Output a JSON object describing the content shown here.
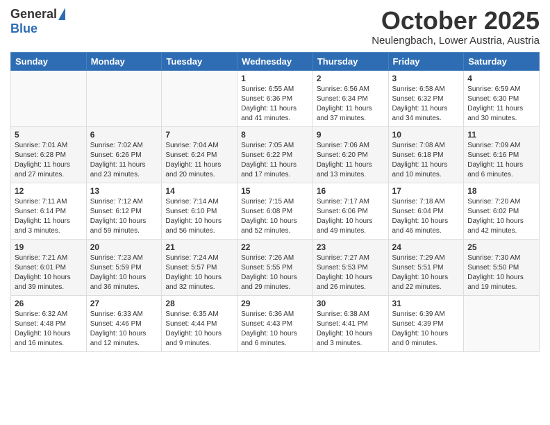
{
  "logo": {
    "general": "General",
    "blue": "Blue"
  },
  "title": "October 2025",
  "location": "Neulengbach, Lower Austria, Austria",
  "weekdays": [
    "Sunday",
    "Monday",
    "Tuesday",
    "Wednesday",
    "Thursday",
    "Friday",
    "Saturday"
  ],
  "weeks": [
    [
      {
        "day": "",
        "info": ""
      },
      {
        "day": "",
        "info": ""
      },
      {
        "day": "",
        "info": ""
      },
      {
        "day": "1",
        "info": "Sunrise: 6:55 AM\nSunset: 6:36 PM\nDaylight: 11 hours\nand 41 minutes."
      },
      {
        "day": "2",
        "info": "Sunrise: 6:56 AM\nSunset: 6:34 PM\nDaylight: 11 hours\nand 37 minutes."
      },
      {
        "day": "3",
        "info": "Sunrise: 6:58 AM\nSunset: 6:32 PM\nDaylight: 11 hours\nand 34 minutes."
      },
      {
        "day": "4",
        "info": "Sunrise: 6:59 AM\nSunset: 6:30 PM\nDaylight: 11 hours\nand 30 minutes."
      }
    ],
    [
      {
        "day": "5",
        "info": "Sunrise: 7:01 AM\nSunset: 6:28 PM\nDaylight: 11 hours\nand 27 minutes."
      },
      {
        "day": "6",
        "info": "Sunrise: 7:02 AM\nSunset: 6:26 PM\nDaylight: 11 hours\nand 23 minutes."
      },
      {
        "day": "7",
        "info": "Sunrise: 7:04 AM\nSunset: 6:24 PM\nDaylight: 11 hours\nand 20 minutes."
      },
      {
        "day": "8",
        "info": "Sunrise: 7:05 AM\nSunset: 6:22 PM\nDaylight: 11 hours\nand 17 minutes."
      },
      {
        "day": "9",
        "info": "Sunrise: 7:06 AM\nSunset: 6:20 PM\nDaylight: 11 hours\nand 13 minutes."
      },
      {
        "day": "10",
        "info": "Sunrise: 7:08 AM\nSunset: 6:18 PM\nDaylight: 11 hours\nand 10 minutes."
      },
      {
        "day": "11",
        "info": "Sunrise: 7:09 AM\nSunset: 6:16 PM\nDaylight: 11 hours\nand 6 minutes."
      }
    ],
    [
      {
        "day": "12",
        "info": "Sunrise: 7:11 AM\nSunset: 6:14 PM\nDaylight: 11 hours\nand 3 minutes."
      },
      {
        "day": "13",
        "info": "Sunrise: 7:12 AM\nSunset: 6:12 PM\nDaylight: 10 hours\nand 59 minutes."
      },
      {
        "day": "14",
        "info": "Sunrise: 7:14 AM\nSunset: 6:10 PM\nDaylight: 10 hours\nand 56 minutes."
      },
      {
        "day": "15",
        "info": "Sunrise: 7:15 AM\nSunset: 6:08 PM\nDaylight: 10 hours\nand 52 minutes."
      },
      {
        "day": "16",
        "info": "Sunrise: 7:17 AM\nSunset: 6:06 PM\nDaylight: 10 hours\nand 49 minutes."
      },
      {
        "day": "17",
        "info": "Sunrise: 7:18 AM\nSunset: 6:04 PM\nDaylight: 10 hours\nand 46 minutes."
      },
      {
        "day": "18",
        "info": "Sunrise: 7:20 AM\nSunset: 6:02 PM\nDaylight: 10 hours\nand 42 minutes."
      }
    ],
    [
      {
        "day": "19",
        "info": "Sunrise: 7:21 AM\nSunset: 6:01 PM\nDaylight: 10 hours\nand 39 minutes."
      },
      {
        "day": "20",
        "info": "Sunrise: 7:23 AM\nSunset: 5:59 PM\nDaylight: 10 hours\nand 36 minutes."
      },
      {
        "day": "21",
        "info": "Sunrise: 7:24 AM\nSunset: 5:57 PM\nDaylight: 10 hours\nand 32 minutes."
      },
      {
        "day": "22",
        "info": "Sunrise: 7:26 AM\nSunset: 5:55 PM\nDaylight: 10 hours\nand 29 minutes."
      },
      {
        "day": "23",
        "info": "Sunrise: 7:27 AM\nSunset: 5:53 PM\nDaylight: 10 hours\nand 26 minutes."
      },
      {
        "day": "24",
        "info": "Sunrise: 7:29 AM\nSunset: 5:51 PM\nDaylight: 10 hours\nand 22 minutes."
      },
      {
        "day": "25",
        "info": "Sunrise: 7:30 AM\nSunset: 5:50 PM\nDaylight: 10 hours\nand 19 minutes."
      }
    ],
    [
      {
        "day": "26",
        "info": "Sunrise: 6:32 AM\nSunset: 4:48 PM\nDaylight: 10 hours\nand 16 minutes."
      },
      {
        "day": "27",
        "info": "Sunrise: 6:33 AM\nSunset: 4:46 PM\nDaylight: 10 hours\nand 12 minutes."
      },
      {
        "day": "28",
        "info": "Sunrise: 6:35 AM\nSunset: 4:44 PM\nDaylight: 10 hours\nand 9 minutes."
      },
      {
        "day": "29",
        "info": "Sunrise: 6:36 AM\nSunset: 4:43 PM\nDaylight: 10 hours\nand 6 minutes."
      },
      {
        "day": "30",
        "info": "Sunrise: 6:38 AM\nSunset: 4:41 PM\nDaylight: 10 hours\nand 3 minutes."
      },
      {
        "day": "31",
        "info": "Sunrise: 6:39 AM\nSunset: 4:39 PM\nDaylight: 10 hours\nand 0 minutes."
      },
      {
        "day": "",
        "info": ""
      }
    ]
  ]
}
